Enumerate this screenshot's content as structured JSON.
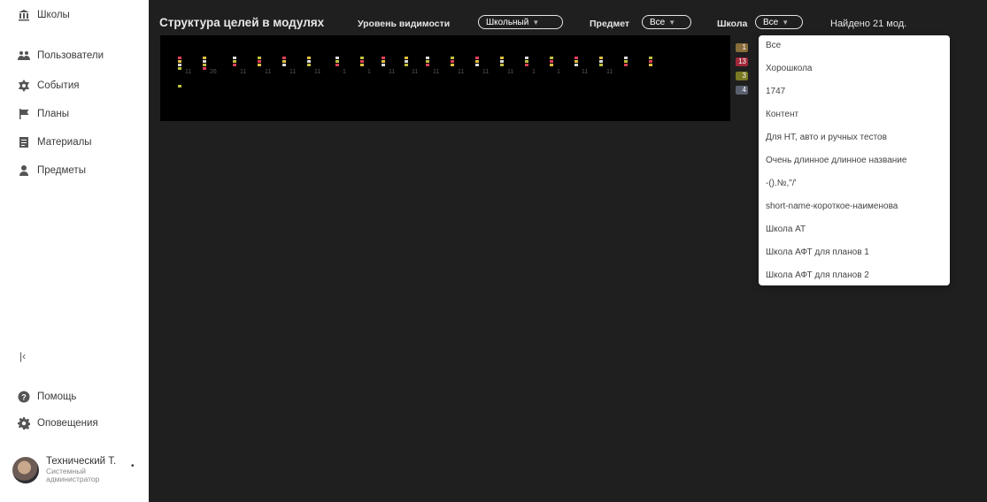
{
  "sidebar": {
    "items": [
      {
        "label": "Школы",
        "icon": "school-icon"
      },
      {
        "label": "Пользователи",
        "icon": "users-icon"
      },
      {
        "label": "События",
        "icon": "events-icon"
      },
      {
        "label": "Планы",
        "icon": "flag-icon"
      },
      {
        "label": "Материалы",
        "icon": "materials-icon"
      },
      {
        "label": "Предметы",
        "icon": "subjects-icon"
      }
    ],
    "collapse": "|‹",
    "help": "Помощь",
    "notifications": "Оповещения",
    "user": {
      "name": "Технический Т.",
      "role": "Системный администратор",
      "menu": "•"
    }
  },
  "header": {
    "title": "Структура целей в модулях",
    "visibility_label": "Уровень видимости",
    "visibility_value": "Школьный",
    "subject_label": "Предмет",
    "subject_value": "Все",
    "school_label": "Школа",
    "school_value": "Все",
    "found": "Найдено 21 мод."
  },
  "legend": [
    {
      "value": "1",
      "color": "#8a6d3b"
    },
    {
      "value": "13",
      "color": "#a0283a"
    },
    {
      "value": "3",
      "color": "#7a7a24"
    },
    {
      "value": "4",
      "color": "#5a6070"
    }
  ],
  "dropdown": {
    "options": [
      "Все",
      "Хорошкола",
      "1747",
      "Контент",
      "Для НТ, авто и ручных тестов",
      "Очень длинное длинное название",
      "-().№,\"/'",
      "short-name-короткое-наименова",
      "Школа АТ",
      "Школа АФТ для планов 1",
      "Школа АФТ для планов 2"
    ]
  },
  "graph": {
    "node_colors": [
      "#e0405a",
      "#e0c040",
      "#d8d8d8",
      "#c0c040"
    ],
    "labels": [
      "11",
      "26",
      "11",
      "11",
      "11",
      "11",
      "1",
      "1",
      "11",
      "11",
      "11",
      "11",
      "11",
      "11",
      "1",
      "1",
      "11",
      "11"
    ]
  }
}
